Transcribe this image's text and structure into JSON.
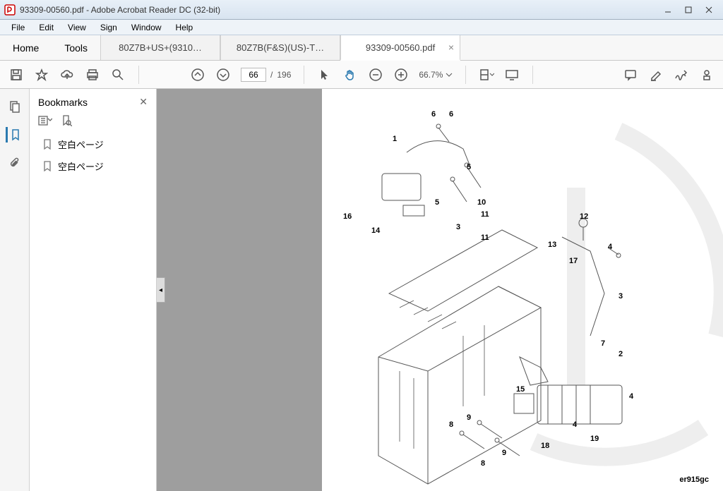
{
  "window": {
    "title": "93309-00560.pdf - Adobe Acrobat Reader DC (32-bit)"
  },
  "menu": {
    "file": "File",
    "edit": "Edit",
    "view": "View",
    "sign": "Sign",
    "window": "Window",
    "help": "Help"
  },
  "tabs": {
    "home": "Home",
    "tools": "Tools",
    "t1": "80Z7B+US+(9310…",
    "t2": "80Z7B(F&S)(US)-T…",
    "t3": "93309-00560.pdf"
  },
  "page": {
    "current": "66",
    "sep": "/",
    "total": "196"
  },
  "zoom": {
    "value": "66.7%"
  },
  "panel": {
    "title": "Bookmarks",
    "bk1": "空白ページ",
    "bk2": "空白ページ"
  },
  "callouts": {
    "c1": "1",
    "c2": "2",
    "c3a": "3",
    "c3b": "3",
    "c4a": "4",
    "c4b": "4",
    "c4c": "4",
    "c5a": "5",
    "c5b": "5",
    "c6a": "6",
    "c6b": "6",
    "c7": "7",
    "c8a": "8",
    "c8b": "8",
    "c9a": "9",
    "c9b": "9",
    "c10": "10",
    "c11a": "11",
    "c11b": "11",
    "c12": "12",
    "c13": "13",
    "c14": "14",
    "c15": "15",
    "c16": "16",
    "c17": "17",
    "c18": "18",
    "c19": "19"
  },
  "figure": {
    "ref": "er915gc"
  }
}
